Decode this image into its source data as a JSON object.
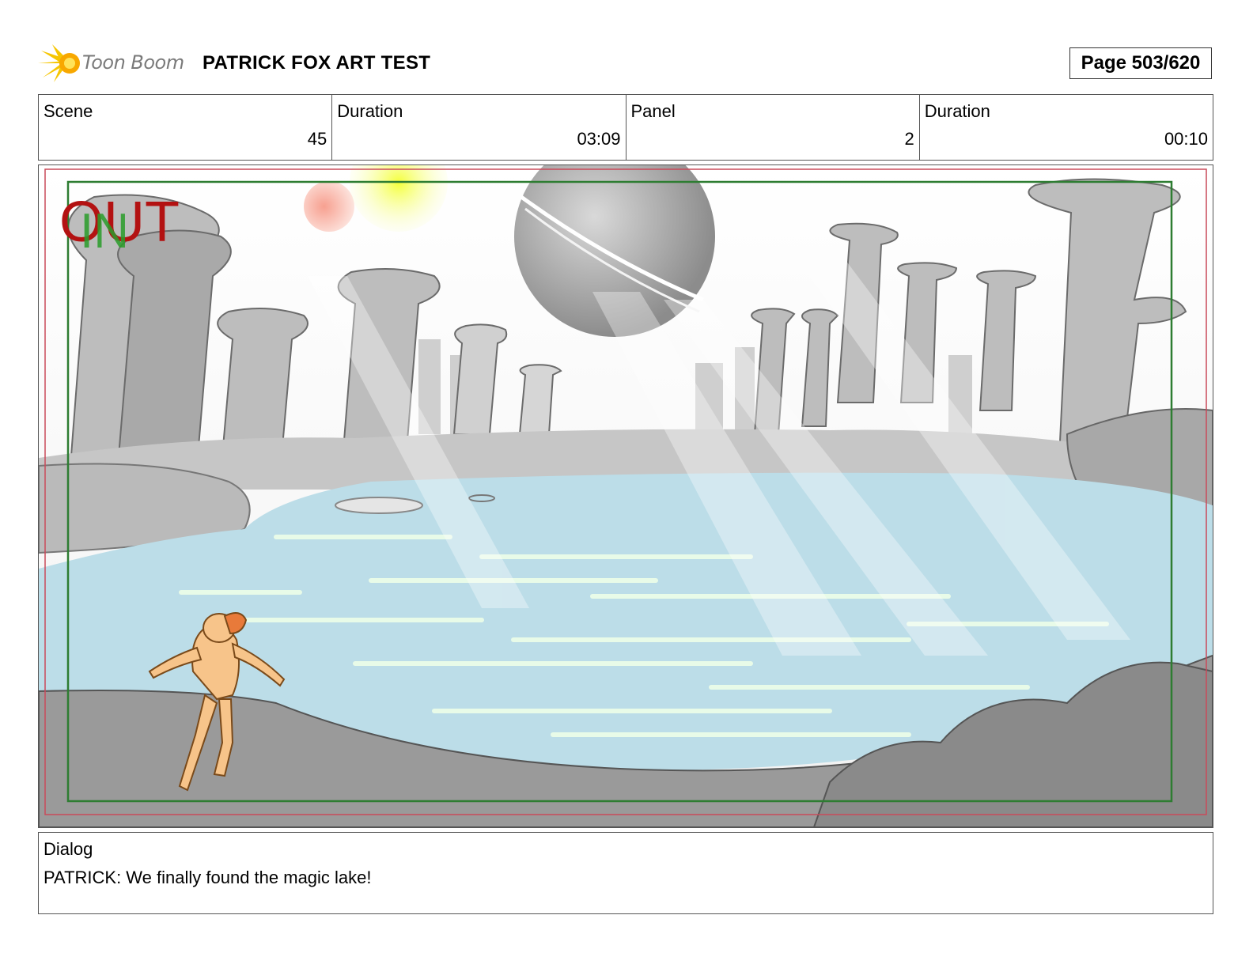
{
  "header": {
    "logo_text": "Toon Boom",
    "project_title": "PATRICK FOX ART TEST",
    "page_label": "Page 503/620"
  },
  "info": {
    "scene_label": "Scene",
    "scene_value": "45",
    "scene_duration_label": "Duration",
    "scene_duration_value": "03:09",
    "panel_label": "Panel",
    "panel_value": "2",
    "panel_duration_label": "Duration",
    "panel_duration_value": "00:10"
  },
  "panel": {
    "out_marker": "OUT",
    "in_marker": "IN",
    "colors": {
      "water": "#bcdde8",
      "water_highlight": "#e8fbe8",
      "rock": "#b5b5b5",
      "ground": "#9a9a9a",
      "character": "#f7c48a",
      "out_marker": "#b31212",
      "in_marker": "#2a9d2a",
      "safe_frame": "#2e7d32",
      "action_frame": "#c94a5a"
    }
  },
  "dialog": {
    "label": "Dialog",
    "text": "PATRICK: We finally found the magic lake!"
  }
}
